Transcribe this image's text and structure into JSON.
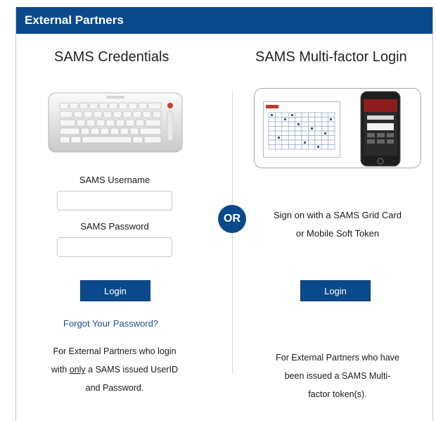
{
  "header": {
    "title": "External Partners"
  },
  "left": {
    "title": "SAMS Credentials",
    "username_label": "SAMS Username",
    "username_value": "",
    "password_label": "SAMS Password",
    "password_value": "",
    "login_label": "Login",
    "forgot_link": "Forgot Your Password?",
    "desc_line1": "For External Partners who login",
    "desc_line2_pre": "with ",
    "desc_line2_only": "only",
    "desc_line2_post": " a SAMS issued UserID",
    "desc_line3": "and Password."
  },
  "separator": {
    "label": "OR"
  },
  "right": {
    "title": "SAMS Multi-factor Login",
    "signon_line1": "Sign on with a SAMS Grid Card",
    "signon_line2": "or Mobile Soft Token",
    "login_label": "Login",
    "desc_line1": "For External Partners who have",
    "desc_line2": "been issued a SAMS Multi-",
    "desc_line3": "factor token(s)."
  },
  "images": {
    "keyboard": "keyboard-icon",
    "grid_card": "grid-card-icon",
    "phone": "mobile-phone-icon"
  },
  "colors": {
    "brand": "#0a4a8c",
    "link": "#1f4f8f"
  }
}
